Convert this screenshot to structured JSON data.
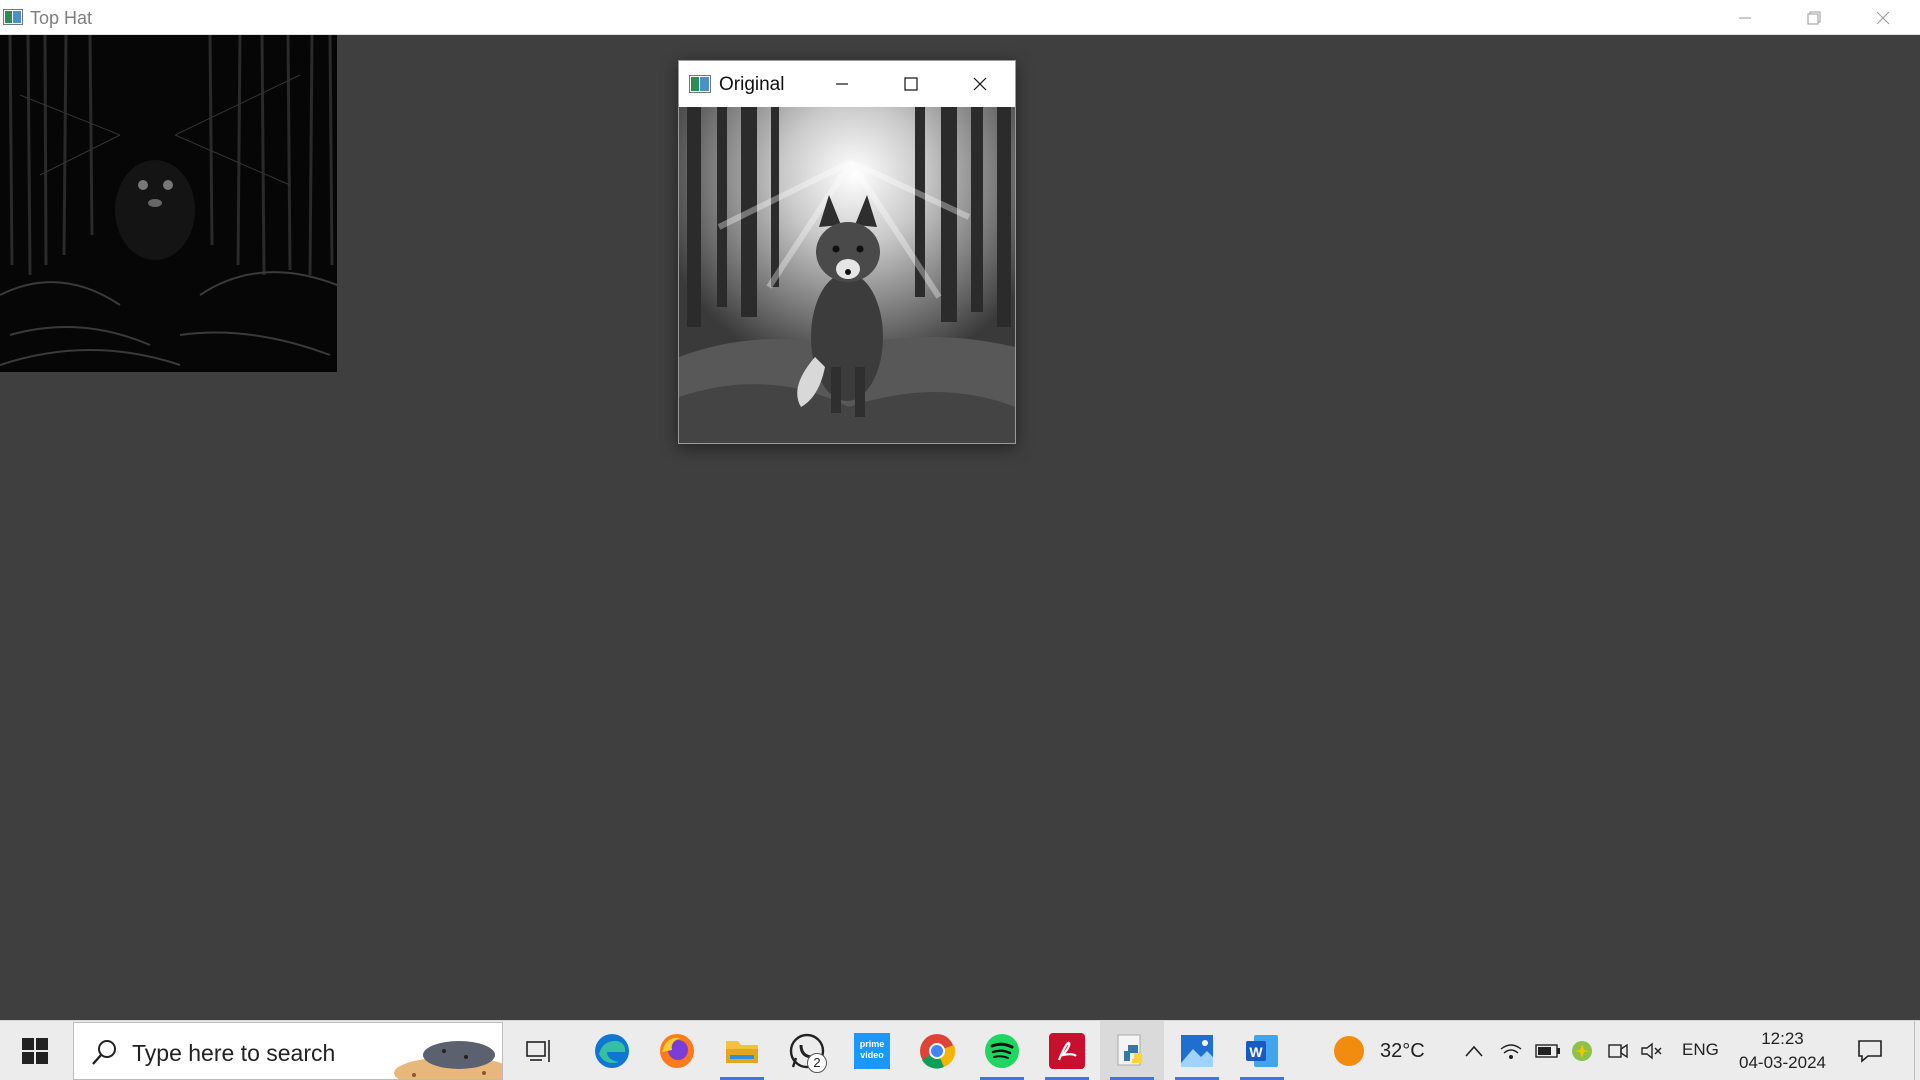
{
  "main_window": {
    "title": "Top Hat",
    "icon": "opencv-window-icon",
    "controls": [
      "minimize-icon",
      "restore-icon",
      "close-icon"
    ]
  },
  "original_window": {
    "title": "Original",
    "icon": "opencv-window-icon",
    "controls": [
      "minimize-icon",
      "maximize-icon",
      "close-icon"
    ]
  },
  "taskbar": {
    "search_placeholder": "Type here to search",
    "apps": [
      {
        "name": "task-view",
        "running": false
      },
      {
        "name": "edge",
        "running": false
      },
      {
        "name": "firefox",
        "running": false
      },
      {
        "name": "file-explorer",
        "running": true
      },
      {
        "name": "whatsapp",
        "running": false,
        "badge": "2"
      },
      {
        "name": "prime-video",
        "running": false,
        "label": "prime video"
      },
      {
        "name": "chrome",
        "running": false
      },
      {
        "name": "spotify",
        "running": true
      },
      {
        "name": "acrobat",
        "running": true
      },
      {
        "name": "python",
        "running": true,
        "active": true
      },
      {
        "name": "photos",
        "running": true
      },
      {
        "name": "word",
        "running": true
      }
    ],
    "weather": {
      "temp": "32°C"
    },
    "language": "ENG",
    "time": "12:23",
    "date": "04-03-2024"
  }
}
